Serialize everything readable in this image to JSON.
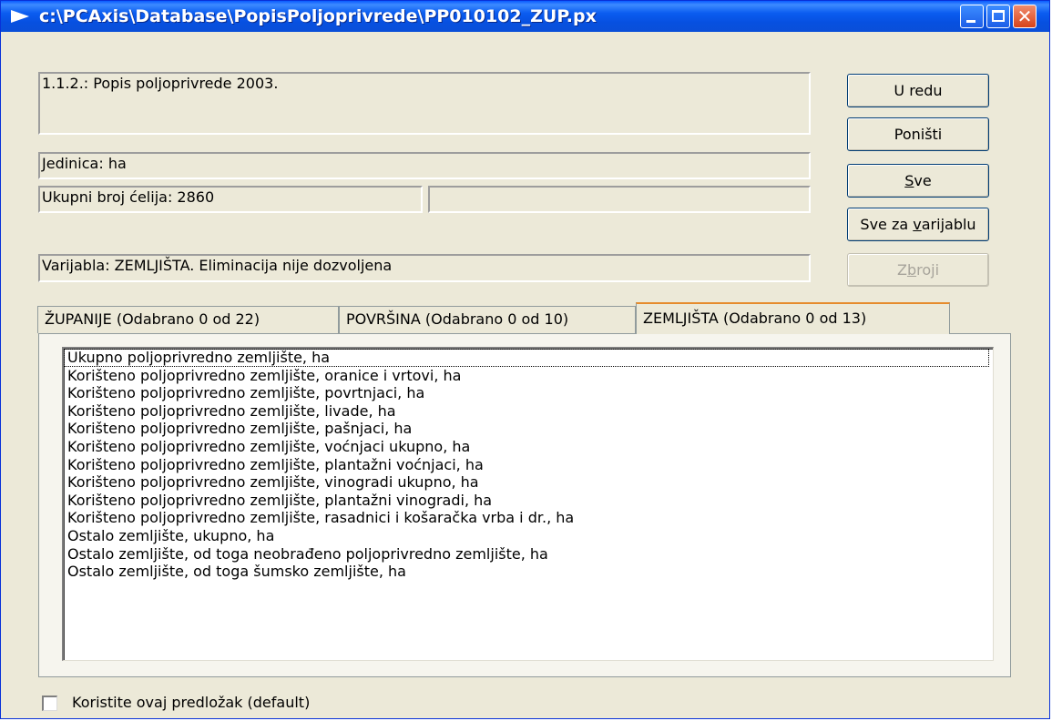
{
  "window": {
    "title": "c:\\PCAxis\\Database\\PopisPoljoprivrede\\PP010102_ZUP.px",
    "minimize_icon": "minimize-icon",
    "maximize_icon": "maximize-icon",
    "close_icon": "close-icon",
    "close_glyph": "✕"
  },
  "info": {
    "description": "1.1.2.: Popis poljoprivrede  2003.",
    "unit": "Jedinica: ha",
    "cell_count": "Ukupni broj ćelija:  2860",
    "cell_count_extra": "",
    "variable": "Varijabla: ZEMLJIŠTA. Eliminacija nije dozvoljena"
  },
  "buttons": {
    "ok": "U redu",
    "cancel": "Poništi",
    "all_prefix": "",
    "all_mnemonic": "S",
    "all_suffix": "ve",
    "all_var_prefix": "Sve za ",
    "all_var_mnemonic": "v",
    "all_var_suffix": "arijablu",
    "sum_prefix": "Z",
    "sum_mnemonic": "b",
    "sum_suffix": "roji",
    "sum_enabled": false
  },
  "tabs": [
    {
      "label": "ŽUPANIJE  (Odabrano 0 od  22)",
      "active": false
    },
    {
      "label": "POVRŠINA  (Odabrano 0 od  10)",
      "active": false
    },
    {
      "label": "ZEMLJIŠTA  (Odabrano 0 od  13)",
      "active": true
    }
  ],
  "list": {
    "items": [
      "Ukupno poljoprivredno zemljište, ha",
      "Korišteno poljoprivredno zemljište, oranice i vrtovi, ha",
      "Korišteno poljoprivredno zemljište, povrtnjaci, ha",
      "Korišteno poljoprivredno zemljište, livade, ha",
      "Korišteno poljoprivredno zemljište, pašnjaci, ha",
      "Korišteno poljoprivredno zemljište, voćnjaci ukupno, ha",
      "Korišteno poljoprivredno zemljište, plantažni voćnjaci, ha",
      "Korišteno poljoprivredno zemljište, vinogradi ukupno, ha",
      "Korišteno poljoprivredno zemljište, plantažni vinogradi, ha",
      "Korišteno poljoprivredno zemljište, rasadnici i košaračka vrba i dr., ha",
      "Ostalo zemljište, ukupno, ha",
      "Ostalo zemljište, od toga neobrađeno poljoprivredno zemljište, ha",
      "Ostalo zemljište, od toga šumsko zemljište, ha"
    ],
    "focused_index": 0
  },
  "template_checkbox": {
    "label": "Koristite ovaj predložak (default)",
    "checked": false
  }
}
